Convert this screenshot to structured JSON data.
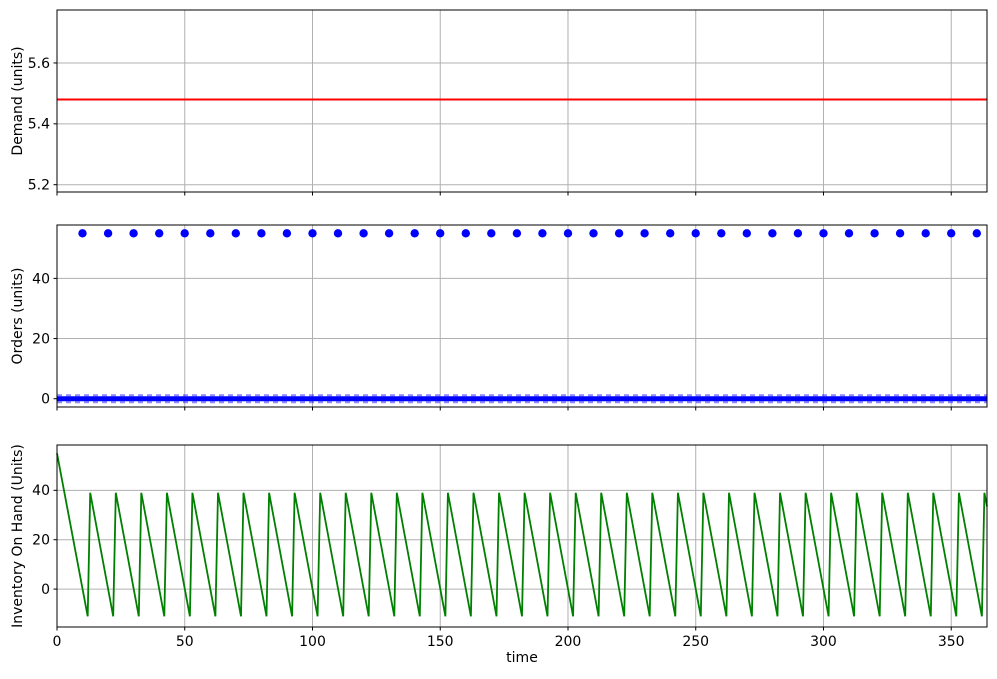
{
  "figure": {
    "background": "#ffffff",
    "frame_color": "#000000",
    "grid_color": "#b0b0b0",
    "grid": true,
    "legend": "none",
    "x_axis_label": "time"
  },
  "chart_data": [
    {
      "type": "line",
      "name": "demand",
      "title": "",
      "ylabel": "Demand (units)",
      "xlabel": "",
      "xlim": [
        0,
        364
      ],
      "ylim": [
        5.176,
        5.774
      ],
      "x_ticks": [
        0,
        50,
        100,
        150,
        200,
        250,
        300,
        350
      ],
      "y_ticks": [
        5.2,
        5.4,
        5.6
      ],
      "grid": true,
      "series": [
        {
          "name": "demand-rate",
          "style": "hline",
          "color": "#ff0000",
          "y": 5.48,
          "x_range": [
            0,
            364
          ]
        }
      ]
    },
    {
      "type": "scatter",
      "name": "orders",
      "title": "",
      "ylabel": "Orders (units)",
      "xlabel": "",
      "xlim": [
        0,
        364
      ],
      "ylim": [
        -2.75,
        57.75
      ],
      "x_ticks": [
        0,
        50,
        100,
        150,
        200,
        250,
        300,
        350
      ],
      "y_ticks": [
        0,
        20,
        40
      ],
      "grid": true,
      "series": [
        {
          "name": "order-events",
          "style": "scatter",
          "marker": "circle",
          "marker_radius": 4.2,
          "color": "#0000ff",
          "y": 55,
          "x": [
            10,
            20,
            30,
            40,
            50,
            60,
            70,
            80,
            90,
            100,
            110,
            120,
            130,
            140,
            150,
            160,
            170,
            180,
            190,
            200,
            210,
            220,
            230,
            240,
            250,
            260,
            270,
            280,
            290,
            300,
            310,
            320,
            330,
            340,
            350,
            360
          ]
        },
        {
          "name": "zero-order-days",
          "style": "thick-band",
          "color": "#0000ff",
          "y": 0,
          "x_range": [
            0,
            364
          ],
          "note": "orders equal 0 on all non-review days; dense round markers merge into a thick band at zero"
        }
      ]
    },
    {
      "type": "line",
      "name": "inventory",
      "title": "",
      "ylabel": "Inventory On Hand (Units)",
      "xlabel": "time",
      "xlim": [
        0,
        364
      ],
      "ylim": [
        -15.35,
        58.35
      ],
      "x_ticks": [
        0,
        50,
        100,
        150,
        200,
        250,
        300,
        350
      ],
      "y_ticks": [
        0,
        20,
        40
      ],
      "grid": true,
      "series": [
        {
          "name": "inventory-on-hand",
          "style": "polyline",
          "color": "#008000",
          "points": [
            [
              0,
              55
            ],
            [
              12,
              -11
            ],
            [
              13,
              39
            ],
            [
              22,
              -11
            ],
            [
              23,
              39
            ],
            [
              32,
              -11
            ],
            [
              33,
              39
            ],
            [
              42,
              -11
            ],
            [
              43,
              39
            ],
            [
              52,
              -11
            ],
            [
              53,
              39
            ],
            [
              62,
              -11
            ],
            [
              63,
              39
            ],
            [
              72,
              -11
            ],
            [
              73,
              39
            ],
            [
              82,
              -11
            ],
            [
              83,
              39
            ],
            [
              92,
              -11
            ],
            [
              93,
              39
            ],
            [
              102,
              -11
            ],
            [
              103,
              39
            ],
            [
              112,
              -11
            ],
            [
              113,
              39
            ],
            [
              122,
              -11
            ],
            [
              123,
              39
            ],
            [
              132,
              -11
            ],
            [
              133,
              39
            ],
            [
              142,
              -11
            ],
            [
              143,
              39
            ],
            [
              152,
              -11
            ],
            [
              153,
              39
            ],
            [
              162,
              -11
            ],
            [
              163,
              39
            ],
            [
              172,
              -11
            ],
            [
              173,
              39
            ],
            [
              182,
              -11
            ],
            [
              183,
              39
            ],
            [
              192,
              -11
            ],
            [
              193,
              39
            ],
            [
              202,
              -11
            ],
            [
              203,
              39
            ],
            [
              212,
              -11
            ],
            [
              213,
              39
            ],
            [
              222,
              -11
            ],
            [
              223,
              39
            ],
            [
              232,
              -11
            ],
            [
              233,
              39
            ],
            [
              242,
              -11
            ],
            [
              243,
              39
            ],
            [
              252,
              -11
            ],
            [
              253,
              39
            ],
            [
              262,
              -11
            ],
            [
              263,
              39
            ],
            [
              272,
              -11
            ],
            [
              273,
              39
            ],
            [
              282,
              -11
            ],
            [
              283,
              39
            ],
            [
              292,
              -11
            ],
            [
              293,
              39
            ],
            [
              302,
              -11
            ],
            [
              303,
              39
            ],
            [
              312,
              -11
            ],
            [
              313,
              39
            ],
            [
              322,
              -11
            ],
            [
              323,
              39
            ],
            [
              332,
              -11
            ],
            [
              333,
              39
            ],
            [
              342,
              -11
            ],
            [
              343,
              39
            ],
            [
              352,
              -11
            ],
            [
              353,
              39
            ],
            [
              362,
              -11
            ],
            [
              363,
              39
            ],
            [
              364,
              33.5
            ]
          ]
        }
      ]
    }
  ]
}
